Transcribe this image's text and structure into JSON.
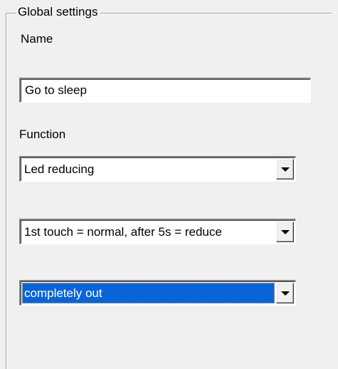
{
  "groupbox": {
    "title": "Global settings"
  },
  "name_field": {
    "label": "Name",
    "value": "Go to sleep"
  },
  "function_field": {
    "label": "Function",
    "selected": "Led reducing"
  },
  "touch_mode": {
    "selected": "1st touch = normal, after 5s = reduce"
  },
  "reduce_level": {
    "selected": "completely out",
    "highlighted": true
  },
  "icons": {
    "dropdown": "chevron-down-icon"
  },
  "colors": {
    "selection_background": "#0a64d8",
    "selection_text": "#ffffff",
    "window_background": "#f0f0f0"
  }
}
